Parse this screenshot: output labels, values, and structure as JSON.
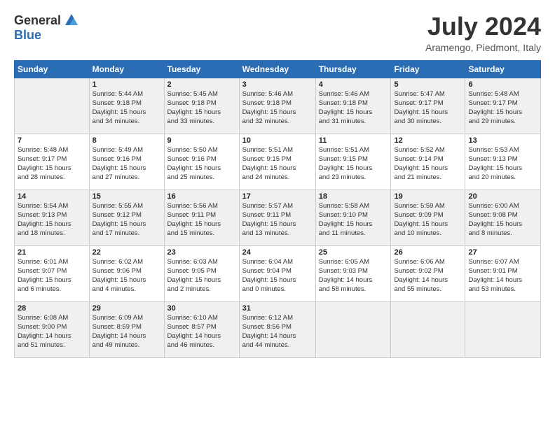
{
  "logo": {
    "general": "General",
    "blue": "Blue"
  },
  "title": {
    "month_year": "July 2024",
    "location": "Aramengo, Piedmont, Italy"
  },
  "calendar": {
    "headers": [
      "Sunday",
      "Monday",
      "Tuesday",
      "Wednesday",
      "Thursday",
      "Friday",
      "Saturday"
    ],
    "rows": [
      [
        {
          "day": "",
          "info": ""
        },
        {
          "day": "1",
          "info": "Sunrise: 5:44 AM\nSunset: 9:18 PM\nDaylight: 15 hours\nand 34 minutes."
        },
        {
          "day": "2",
          "info": "Sunrise: 5:45 AM\nSunset: 9:18 PM\nDaylight: 15 hours\nand 33 minutes."
        },
        {
          "day": "3",
          "info": "Sunrise: 5:46 AM\nSunset: 9:18 PM\nDaylight: 15 hours\nand 32 minutes."
        },
        {
          "day": "4",
          "info": "Sunrise: 5:46 AM\nSunset: 9:18 PM\nDaylight: 15 hours\nand 31 minutes."
        },
        {
          "day": "5",
          "info": "Sunrise: 5:47 AM\nSunset: 9:17 PM\nDaylight: 15 hours\nand 30 minutes."
        },
        {
          "day": "6",
          "info": "Sunrise: 5:48 AM\nSunset: 9:17 PM\nDaylight: 15 hours\nand 29 minutes."
        }
      ],
      [
        {
          "day": "7",
          "info": "Sunrise: 5:48 AM\nSunset: 9:17 PM\nDaylight: 15 hours\nand 28 minutes."
        },
        {
          "day": "8",
          "info": "Sunrise: 5:49 AM\nSunset: 9:16 PM\nDaylight: 15 hours\nand 27 minutes."
        },
        {
          "day": "9",
          "info": "Sunrise: 5:50 AM\nSunset: 9:16 PM\nDaylight: 15 hours\nand 25 minutes."
        },
        {
          "day": "10",
          "info": "Sunrise: 5:51 AM\nSunset: 9:15 PM\nDaylight: 15 hours\nand 24 minutes."
        },
        {
          "day": "11",
          "info": "Sunrise: 5:51 AM\nSunset: 9:15 PM\nDaylight: 15 hours\nand 23 minutes."
        },
        {
          "day": "12",
          "info": "Sunrise: 5:52 AM\nSunset: 9:14 PM\nDaylight: 15 hours\nand 21 minutes."
        },
        {
          "day": "13",
          "info": "Sunrise: 5:53 AM\nSunset: 9:13 PM\nDaylight: 15 hours\nand 20 minutes."
        }
      ],
      [
        {
          "day": "14",
          "info": "Sunrise: 5:54 AM\nSunset: 9:13 PM\nDaylight: 15 hours\nand 18 minutes."
        },
        {
          "day": "15",
          "info": "Sunrise: 5:55 AM\nSunset: 9:12 PM\nDaylight: 15 hours\nand 17 minutes."
        },
        {
          "day": "16",
          "info": "Sunrise: 5:56 AM\nSunset: 9:11 PM\nDaylight: 15 hours\nand 15 minutes."
        },
        {
          "day": "17",
          "info": "Sunrise: 5:57 AM\nSunset: 9:11 PM\nDaylight: 15 hours\nand 13 minutes."
        },
        {
          "day": "18",
          "info": "Sunrise: 5:58 AM\nSunset: 9:10 PM\nDaylight: 15 hours\nand 11 minutes."
        },
        {
          "day": "19",
          "info": "Sunrise: 5:59 AM\nSunset: 9:09 PM\nDaylight: 15 hours\nand 10 minutes."
        },
        {
          "day": "20",
          "info": "Sunrise: 6:00 AM\nSunset: 9:08 PM\nDaylight: 15 hours\nand 8 minutes."
        }
      ],
      [
        {
          "day": "21",
          "info": "Sunrise: 6:01 AM\nSunset: 9:07 PM\nDaylight: 15 hours\nand 6 minutes."
        },
        {
          "day": "22",
          "info": "Sunrise: 6:02 AM\nSunset: 9:06 PM\nDaylight: 15 hours\nand 4 minutes."
        },
        {
          "day": "23",
          "info": "Sunrise: 6:03 AM\nSunset: 9:05 PM\nDaylight: 15 hours\nand 2 minutes."
        },
        {
          "day": "24",
          "info": "Sunrise: 6:04 AM\nSunset: 9:04 PM\nDaylight: 15 hours\nand 0 minutes."
        },
        {
          "day": "25",
          "info": "Sunrise: 6:05 AM\nSunset: 9:03 PM\nDaylight: 14 hours\nand 58 minutes."
        },
        {
          "day": "26",
          "info": "Sunrise: 6:06 AM\nSunset: 9:02 PM\nDaylight: 14 hours\nand 55 minutes."
        },
        {
          "day": "27",
          "info": "Sunrise: 6:07 AM\nSunset: 9:01 PM\nDaylight: 14 hours\nand 53 minutes."
        }
      ],
      [
        {
          "day": "28",
          "info": "Sunrise: 6:08 AM\nSunset: 9:00 PM\nDaylight: 14 hours\nand 51 minutes."
        },
        {
          "day": "29",
          "info": "Sunrise: 6:09 AM\nSunset: 8:59 PM\nDaylight: 14 hours\nand 49 minutes."
        },
        {
          "day": "30",
          "info": "Sunrise: 6:10 AM\nSunset: 8:57 PM\nDaylight: 14 hours\nand 46 minutes."
        },
        {
          "day": "31",
          "info": "Sunrise: 6:12 AM\nSunset: 8:56 PM\nDaylight: 14 hours\nand 44 minutes."
        },
        {
          "day": "",
          "info": ""
        },
        {
          "day": "",
          "info": ""
        },
        {
          "day": "",
          "info": ""
        }
      ]
    ],
    "shaded_rows": [
      0,
      2,
      4
    ]
  }
}
